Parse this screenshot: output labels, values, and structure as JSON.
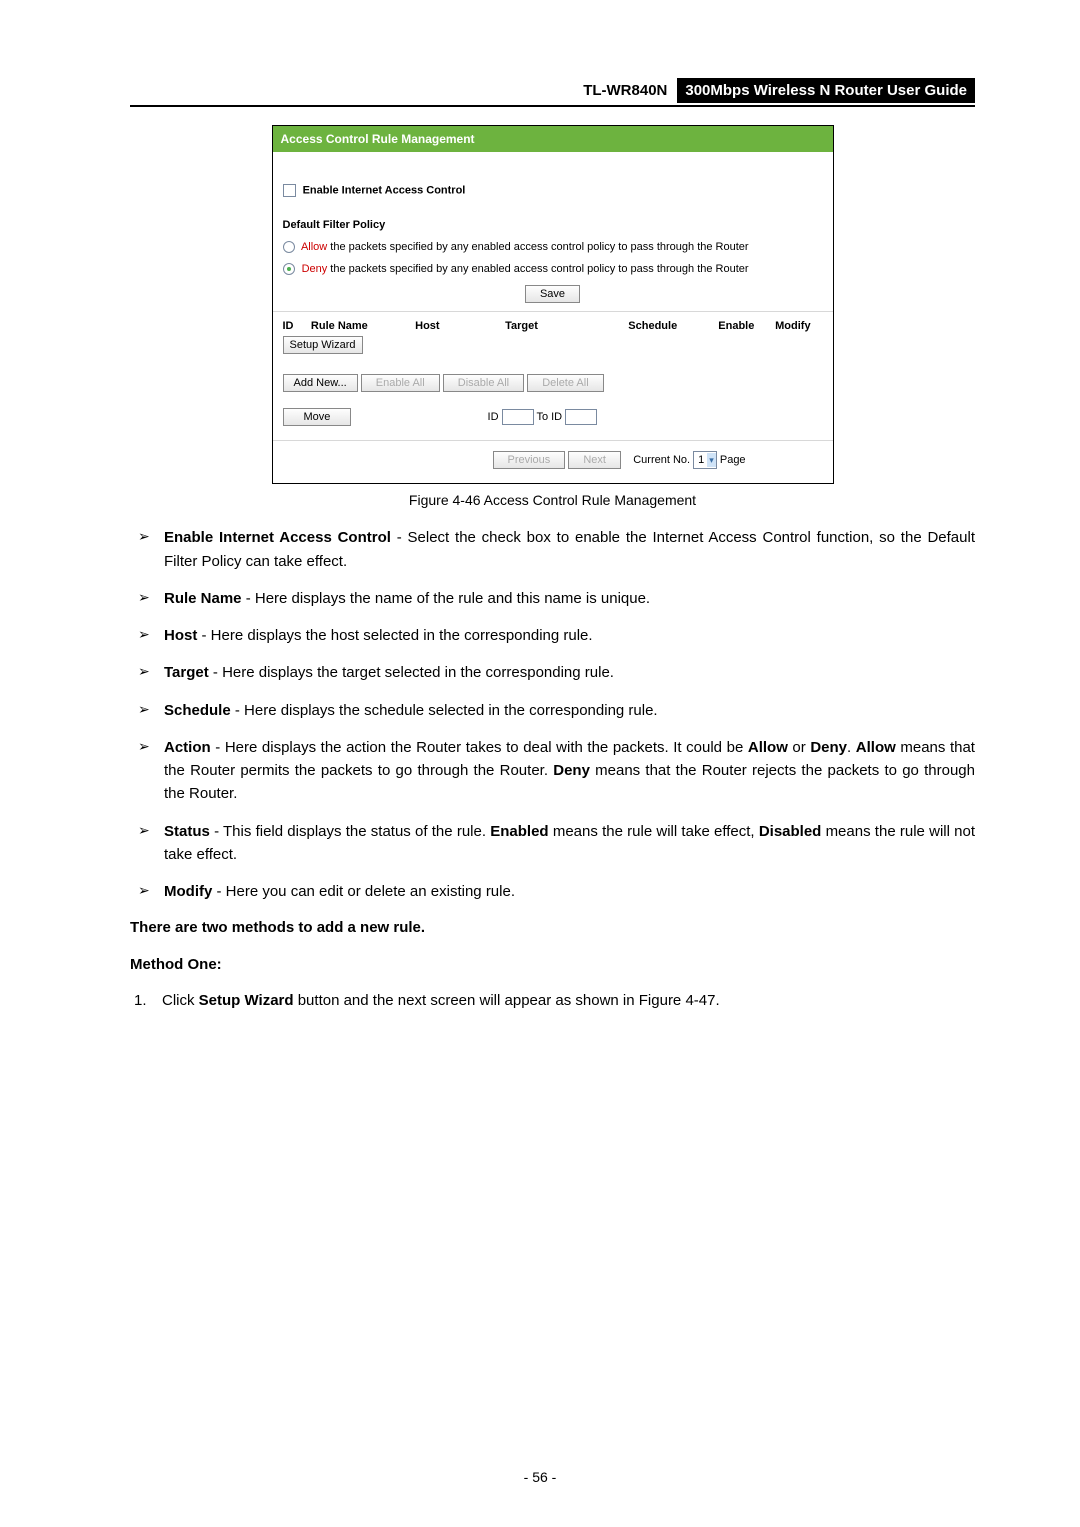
{
  "header": {
    "model": "TL-WR840N",
    "title": "300Mbps Wireless N Router User Guide"
  },
  "figure": {
    "titlebar": "Access Control Rule Management",
    "enable_label": "Enable Internet Access Control",
    "policy_heading": "Default Filter Policy",
    "radio_allow_prefix": "Allow",
    "radio_allow_rest": " the packets specified by any enabled access control policy to pass through the Router",
    "radio_deny_prefix": "Deny",
    "radio_deny_rest": " the packets specified by any enabled access control policy to pass through the Router",
    "save_btn": "Save",
    "cols": {
      "id": "ID",
      "rule": "Rule Name",
      "host": "Host",
      "target": "Target",
      "schedule": "Schedule",
      "enable": "Enable",
      "modify": "Modify"
    },
    "setup_wizard": "Setup Wizard",
    "add_new": "Add New...",
    "enable_all": "Enable All",
    "disable_all": "Disable All",
    "delete_all": "Delete All",
    "move_btn": "Move",
    "move_id_label": "ID",
    "move_to_label": "To ID",
    "prev_btn": "Previous",
    "next_btn": "Next",
    "current_no_label": "Current No.",
    "current_no_value": "1",
    "page_label": "Page"
  },
  "caption": "Figure 4-46    Access Control Rule Management",
  "bullets": [
    {
      "b": "Enable Internet Access Control",
      "rest": " - Select the check box to enable the Internet Access Control function, so the Default Filter Policy can take effect."
    },
    {
      "b": "Rule Name",
      "rest": " - Here displays the name of the rule and this name is unique."
    },
    {
      "b": "Host",
      "rest": " - Here displays the host selected in the corresponding rule."
    },
    {
      "b": "Target",
      "rest": " - Here displays the target selected in the corresponding rule."
    },
    {
      "b": "Schedule",
      "rest": " - Here displays the schedule selected in the corresponding rule."
    }
  ],
  "action_bullet": {
    "b1": "Action",
    "t1": " - Here displays the action the Router takes to deal with the packets. It could be ",
    "b2": "Allow",
    "t2": " or ",
    "b3": "Deny",
    "t3": ". ",
    "b4": "Allow",
    "t4": " means that the Router permits the packets to go through the Router. ",
    "b5": "Deny",
    "t5": " means that the Router rejects the packets to go through the Router."
  },
  "status_bullet": {
    "b1": "Status",
    "t1": " - This field displays the status of the rule. ",
    "b2": "Enabled",
    "t2": " means the rule will take effect, ",
    "b3": "Disabled",
    "t3": " means the rule will not take effect."
  },
  "modify_bullet": {
    "b": "Modify",
    "rest": " - Here you can edit or delete an existing rule."
  },
  "methods_intro": "There are two methods to add a new rule.",
  "method_one": "Method One:",
  "step1": {
    "pre": "Click ",
    "b": "Setup Wizard",
    "post": " button and the next screen will appear as shown in Figure 4-47."
  },
  "page_number": "- 56 -"
}
